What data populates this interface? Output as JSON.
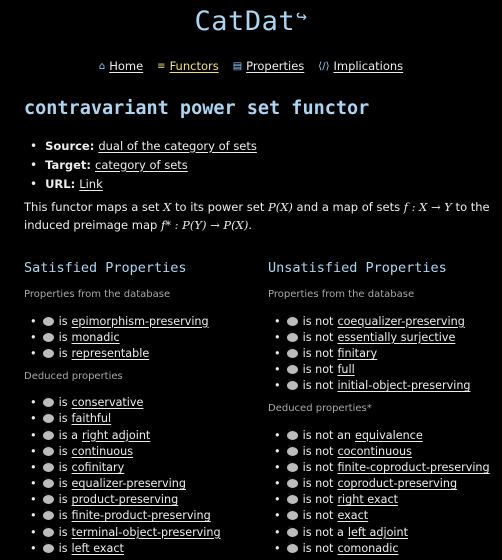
{
  "logo": {
    "text": "CatDat",
    "arrow": "↪"
  },
  "nav": [
    {
      "label": "Home",
      "icon": "home-icon"
    },
    {
      "label": "Functors",
      "icon": "database-icon",
      "active": true
    },
    {
      "label": "Properties",
      "icon": "book-icon"
    },
    {
      "label": "Implications",
      "icon": "code-icon"
    }
  ],
  "page_title": "contravariant power set functor",
  "meta": {
    "source_label": "Source:",
    "source_value": "dual of the category of sets",
    "target_label": "Target:",
    "target_value": "category of sets",
    "url_label": "URL:",
    "url_value": "Link"
  },
  "description": {
    "p1": "This functor maps a set ",
    "x1": "X",
    "p2": " to its power set ",
    "px": "P(X)",
    "p3": " and a map of sets ",
    "f": "f : X → Y",
    "p4": " to the induced preimage map ",
    "fstar": "f* : P(Y) → P(X)",
    "p5": "."
  },
  "satisfied": {
    "heading": "Satisfied Properties",
    "db_label": "Properties from the database",
    "db_items": [
      {
        "prefix": "is",
        "link": "epimorphism-preserving"
      },
      {
        "prefix": "is",
        "link": "monadic"
      },
      {
        "prefix": "is",
        "link": "representable"
      }
    ],
    "deduced_label": "Deduced properties",
    "deduced_items": [
      {
        "prefix": "is",
        "link": "conservative"
      },
      {
        "prefix": "is",
        "link": "faithful"
      },
      {
        "prefix": "is a",
        "link": "right adjoint"
      },
      {
        "prefix": "is",
        "link": "continuous"
      },
      {
        "prefix": "is",
        "link": "cofinitary"
      },
      {
        "prefix": "is",
        "link": "equalizer-preserving"
      },
      {
        "prefix": "is",
        "link": "product-preserving"
      },
      {
        "prefix": "is",
        "link": "finite-product-preserving"
      },
      {
        "prefix": "is",
        "link": "terminal-object-preserving"
      },
      {
        "prefix": "is",
        "link": "left exact"
      }
    ]
  },
  "unsatisfied": {
    "heading": "Unsatisfied Properties",
    "db_label": "Properties from the database",
    "db_items": [
      {
        "prefix": "is not",
        "link": "coequalizer-preserving"
      },
      {
        "prefix": "is not",
        "link": "essentially surjective"
      },
      {
        "prefix": "is not",
        "link": "finitary"
      },
      {
        "prefix": "is not",
        "link": "full"
      },
      {
        "prefix": "is not",
        "link": "initial-object-preserving"
      }
    ],
    "deduced_label": "Deduced properties*",
    "deduced_items": [
      {
        "prefix": "is not an",
        "link": "equivalence"
      },
      {
        "prefix": "is not",
        "link": "cocontinuous"
      },
      {
        "prefix": "is not",
        "link": "finite-coproduct-preserving"
      },
      {
        "prefix": "is not",
        "link": "coproduct-preserving"
      },
      {
        "prefix": "is not",
        "link": "right exact"
      },
      {
        "prefix": "is not",
        "link": "exact"
      },
      {
        "prefix": "is not a",
        "link": "left adjoint"
      },
      {
        "prefix": "is not",
        "link": "comonadic"
      }
    ]
  }
}
